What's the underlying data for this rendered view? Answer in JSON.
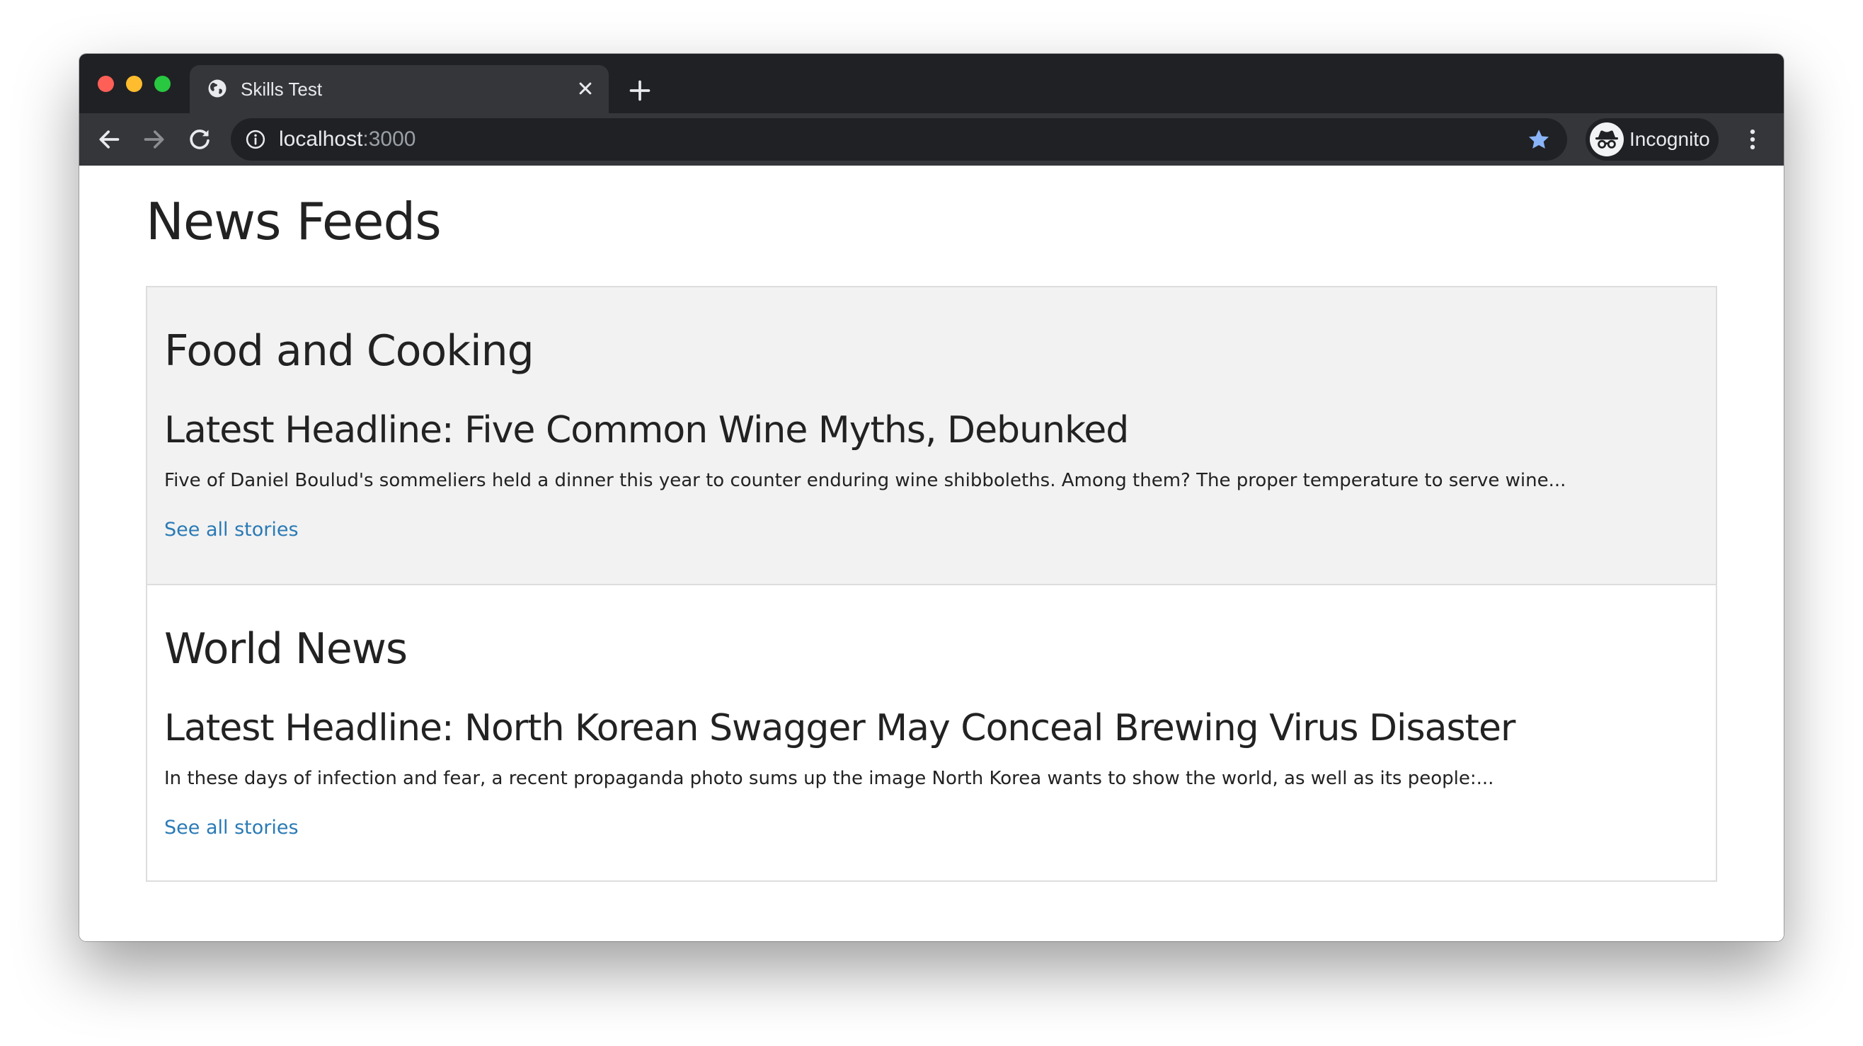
{
  "browser": {
    "tab": {
      "title": "Skills Test",
      "favicon": "globe-icon"
    },
    "address_bar": {
      "host": "localhost",
      "port": ":3000"
    },
    "profile_label": "Incognito",
    "colors": {
      "tabstrip_bg": "#202124",
      "toolbar_bg": "#35363a",
      "star_accent": "#8ab4f8",
      "close_red": "#fe5f57",
      "minimize_yellow": "#febc2e",
      "zoom_green": "#28c840"
    },
    "icons": [
      "back-arrow-icon",
      "forward-arrow-icon",
      "reload-icon",
      "info-icon",
      "star-icon",
      "incognito-icon",
      "kebab-menu-icon",
      "close-icon",
      "plus-icon"
    ]
  },
  "page": {
    "title": "News Feeds",
    "link_color": "#2a7ab5",
    "feeds": [
      {
        "name": "Food and Cooking",
        "headline": "Latest Headline: Five Common Wine Myths, Debunked",
        "summary": "Five of Daniel Boulud's sommeliers held a dinner this year to counter enduring wine shibboleths. Among them? The proper temperature to serve wine...",
        "link_label": "See all stories"
      },
      {
        "name": "World News",
        "headline": "Latest Headline: North Korean Swagger May Conceal Brewing Virus Disaster",
        "summary": "In these days of infection and fear, a recent propaganda photo sums up the image North Korea wants to show the world, as well as its people:...",
        "link_label": "See all stories"
      }
    ]
  }
}
